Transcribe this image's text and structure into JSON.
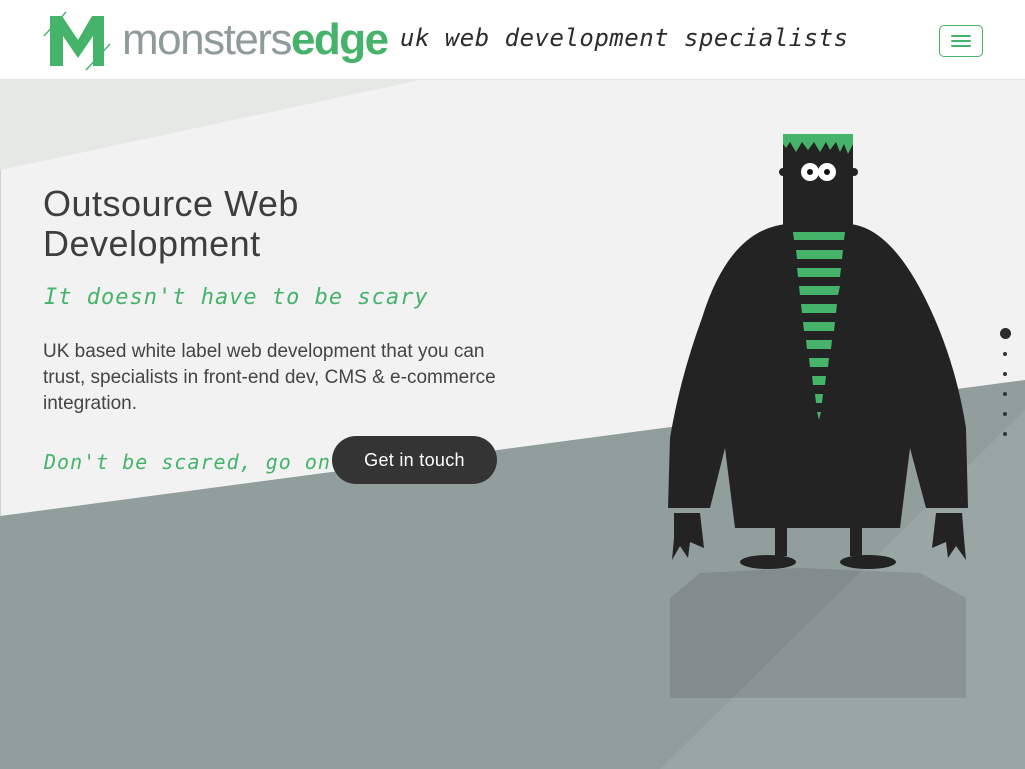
{
  "header": {
    "brand_part1": "monsters",
    "brand_part2": "edge",
    "tagline": "uk web development specialists",
    "menu_icon": "hamburger-icon"
  },
  "hero": {
    "headline": "Outsource Web Development",
    "subheadline": "It doesn't have to be scary",
    "description": "UK based white label web development that you can trust, specialists in front-end dev, CMS & e-commerce integration.",
    "cta_text": "Don't be scared, go on...",
    "cta_button": "Get in touch"
  },
  "pager": {
    "count": 6,
    "active": 0
  },
  "colors": {
    "brand_green": "#45b36a",
    "brand_grey": "#8f9a9b",
    "dark": "#2b2b2b",
    "slate": "#939f9d"
  }
}
